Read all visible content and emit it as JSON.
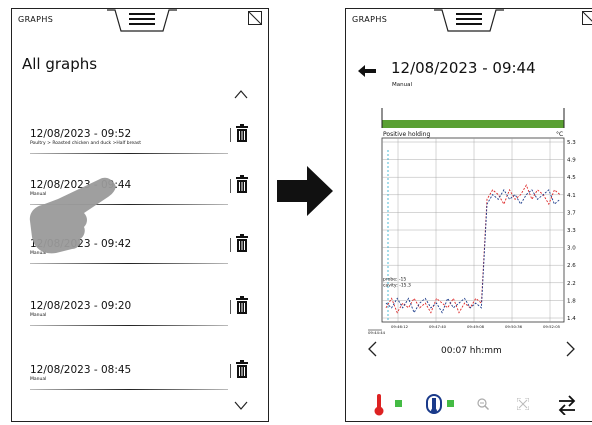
{
  "left_screen": {
    "app_label": "GRAPHS",
    "title": "All graphs",
    "items": [
      {
        "date": "12/08/2023 - 09:52",
        "subtitle": "Poultry > Roasted chicken and duck >Half breast"
      },
      {
        "date": "12/08/2023 - 09:44",
        "subtitle": "Manual"
      },
      {
        "date": "12/08/2023 - 09:42",
        "subtitle": "Manual"
      },
      {
        "date": "12/08/2023 - 09:20",
        "subtitle": "Manual"
      },
      {
        "date": "12/08/2023 - 08:45",
        "subtitle": "Manual"
      }
    ]
  },
  "right_screen": {
    "app_label": "GRAPHS",
    "title": "12/08/2023 - 09:44",
    "subtitle": "Manual",
    "time_range": "00:07 hh:mm",
    "legend_colors": {
      "probe": "#dd2222",
      "cavity": "#1a3a8a",
      "active": "#44bb44"
    }
  },
  "chart_data": {
    "type": "line",
    "phase_label": "Positive holding",
    "phase_color": "#5aa033",
    "unit": "°C",
    "y_ticks": [
      "5.3",
      "4.9",
      "4.5",
      "4.1",
      "3.7",
      "3.3",
      "3.0",
      "2.6",
      "2.2",
      "1.8",
      "1.4"
    ],
    "x_ticks": [
      "09:46:12",
      "09:47:40",
      "09:49:08",
      "09:50:36",
      "09:52:05"
    ],
    "start_label": "09:44:44",
    "annotation_probe": "probe: -15",
    "annotation_cavity": "cavity: -15.3",
    "ylim": [
      1.4,
      5.3
    ],
    "series": [
      {
        "values": [
          1.7,
          1.9,
          1.6,
          1.8,
          1.7,
          1.9,
          1.7,
          1.8,
          1.6,
          1.9,
          1.8,
          1.7,
          1.9,
          1.6,
          1.8,
          1.7,
          1.9,
          1.8,
          4.0,
          4.2,
          4.1,
          3.9,
          4.2,
          4.0,
          4.1,
          4.3,
          4.0,
          4.2,
          4.1,
          3.9,
          4.2,
          4.1
        ]
      },
      {
        "values": [
          1.8,
          1.7,
          1.9,
          1.7,
          1.9,
          1.6,
          1.8,
          1.9,
          1.7,
          1.8,
          1.6,
          1.9,
          1.7,
          1.8,
          1.9,
          1.7,
          1.8,
          1.7,
          3.9,
          4.1,
          4.0,
          4.2,
          4.0,
          4.1,
          3.9,
          4.1,
          4.2,
          4.0,
          4.1,
          4.2,
          3.9,
          4.0
        ]
      }
    ]
  }
}
